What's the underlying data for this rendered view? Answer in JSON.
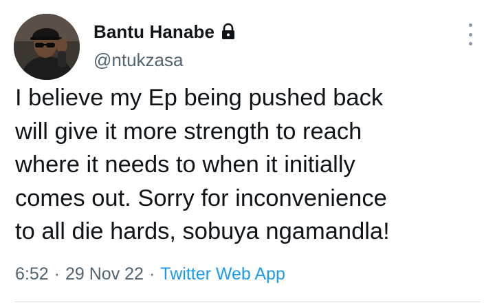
{
  "author": {
    "display_name": "Bantu Hanabe",
    "handle": "@ntukzasa",
    "protected_icon": "lock-icon",
    "avatar_icon": "avatar-photo"
  },
  "tweet": {
    "text": "I believe my Ep being pushed back\nwill give it more strength to reach\nwhere it needs to when it initially\ncomes out. Sorry for inconvenience\nto all die hards, sobuya ngamandla!",
    "time": "6:52",
    "separator": "·",
    "date": "29 Nov 22",
    "source": "Twitter Web App"
  },
  "menu": {
    "icon": "more-vertical-icon"
  },
  "colors": {
    "text": "#0f1419",
    "secondary": "#536471",
    "link": "#1d9bf0",
    "divider": "#cfd9de"
  }
}
